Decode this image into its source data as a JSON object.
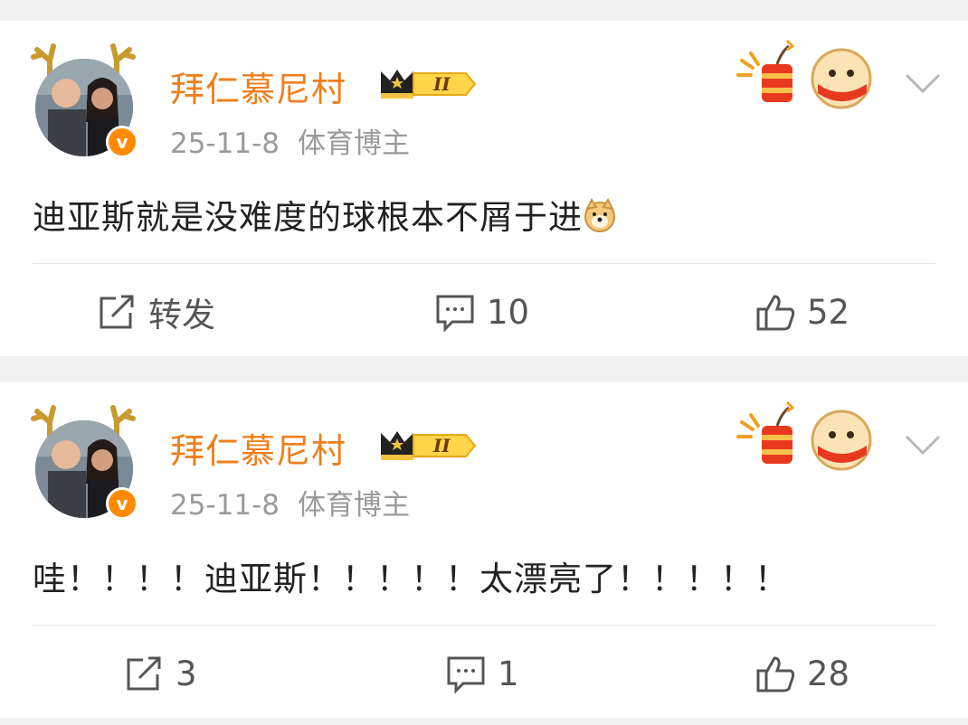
{
  "posts": [
    {
      "username": "拜仁慕尼村",
      "vip_level": "II",
      "date": "25-11-8",
      "role": "体育博主",
      "content": "迪亚斯就是没难度的球根本不屑于进",
      "content_emoji": "doge-emoji",
      "actions": {
        "repost": "转发",
        "comment": "10",
        "like": "52"
      }
    },
    {
      "username": "拜仁慕尼村",
      "vip_level": "II",
      "date": "25-11-8",
      "role": "体育博主",
      "content": "哇！！！！迪亚斯！！！！！太漂亮了！！！！！",
      "actions": {
        "repost": "3",
        "comment": "1",
        "like": "28"
      }
    }
  ],
  "colors": {
    "username": "#f07f1c",
    "verified_badge": "#ff8a00",
    "meta_text": "#9a9a9a"
  }
}
